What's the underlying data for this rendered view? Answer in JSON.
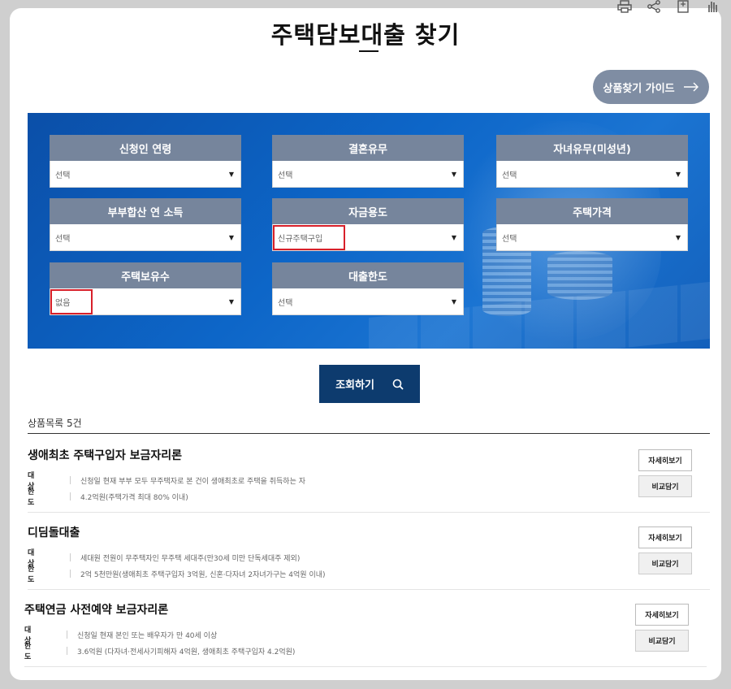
{
  "page": {
    "title": "주택담보대출 찾기",
    "guide_button": "상품찾기 가이드"
  },
  "filters": [
    {
      "label": "신청인 연령",
      "value": "선택",
      "highlight": false
    },
    {
      "label": "결혼유무",
      "value": "선택",
      "highlight": false
    },
    {
      "label": "자녀유무(미성년)",
      "value": "선택",
      "highlight": false
    },
    {
      "label": "부부합산 연 소득",
      "value": "선택",
      "highlight": false
    },
    {
      "label": "자금용도",
      "value": "신규주택구입",
      "highlight": true
    },
    {
      "label": "주택가격",
      "value": "선택",
      "highlight": false
    },
    {
      "label": "주택보유수",
      "value": "없음",
      "highlight": true
    },
    {
      "label": "대출한도",
      "value": "선택",
      "highlight": false
    }
  ],
  "search_button": "조회하기",
  "results": {
    "count_label": "상품목록 5건",
    "detail_label": "자세히보기",
    "compare_label": "비교담기",
    "target_key": "대 상",
    "limit_key": "한 도",
    "items": [
      {
        "name": "생애최초 주택구입자 보금자리론",
        "target": "신청일 현재 부부 모두 무주택자로 본 건이 생애최초로 주택을 취득하는 자",
        "limit": "4.2억원(주택가격 최대 80% 이내)"
      },
      {
        "name": "디딤돌대출",
        "target": "세대원 전원이 무주택자인 무주택 세대주(만30세 미만 단독세대주 제외)",
        "limit": "2억 5천만원(생애최초 주택구입자 3억원, 신혼·다자녀 2자녀가구는 4억원 이내)"
      },
      {
        "name": "주택연금 사전예약 보금자리론",
        "target": "신청일 현재 본인 또는 배우자가 만 40세 이상",
        "limit": "3.6억원 (다자녀·전세사기피해자 4억원, 생애최초 주택구입자 4.2억원)"
      }
    ]
  },
  "icons": [
    "print-icon",
    "share-icon",
    "bookmark-icon",
    "hand-icon",
    "arrow-right-icon",
    "search-icon",
    "dropdown-arrow-icon"
  ],
  "colors": {
    "panel": "#0d66c8",
    "label_bg": "#76859c",
    "search_btn": "#0d3b6e",
    "highlight": "#d8202a"
  }
}
